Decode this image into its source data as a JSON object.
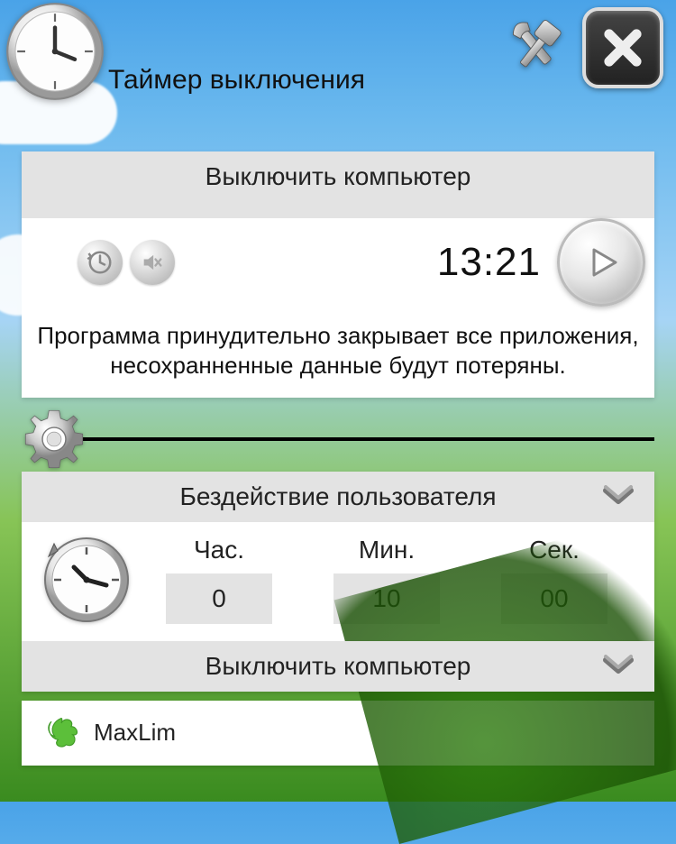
{
  "header": {
    "title": "Таймер выключения"
  },
  "top_panel": {
    "action_label": "Выключить компьютер",
    "time": "13:21",
    "warning": "Программа принудительно закрывает все приложения, несохранненные данные будут потеряны."
  },
  "settings": {
    "condition_label": "Бездействие пользователя",
    "hours_label": "Час.",
    "minutes_label": "Мин.",
    "seconds_label": "Сек.",
    "hours_value": "0",
    "minutes_value": "10",
    "seconds_value": "00",
    "action_label": "Выключить компьютер"
  },
  "footer": {
    "brand": "MaxLim"
  }
}
